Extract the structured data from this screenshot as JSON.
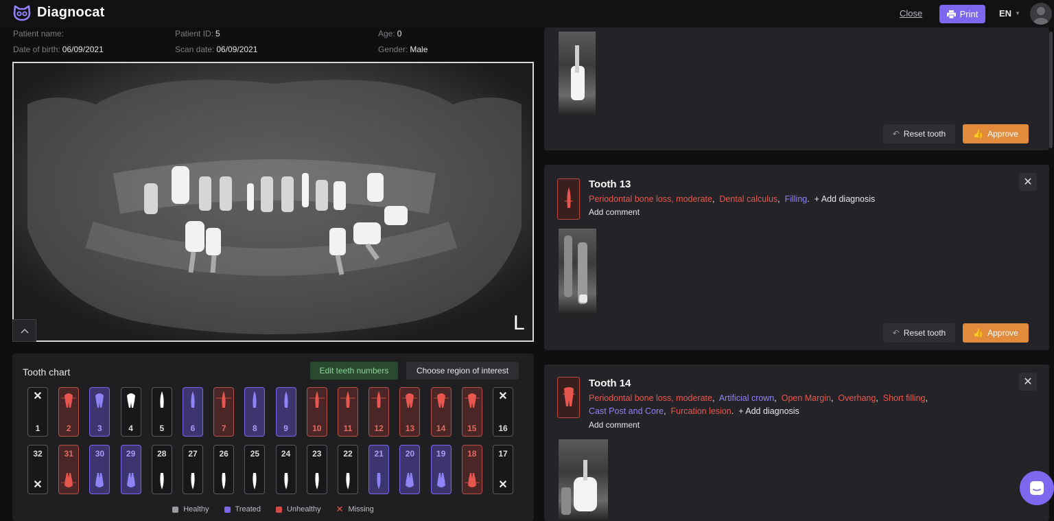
{
  "header": {
    "logo_text": "Diagnocat",
    "close_label": "Close",
    "print_label": "Print",
    "language": "EN"
  },
  "patient": {
    "name_label": "Patient name:",
    "name_value": "",
    "id_label": "Patient ID:",
    "id_value": "5",
    "age_label": "Age:",
    "age_value": "0",
    "dob_label": "Date of birth:",
    "dob_value": "06/09/2021",
    "scan_label": "Scan date:",
    "scan_value": "06/09/2021",
    "gender_label": "Gender:",
    "gender_value": "Male"
  },
  "xray": {
    "corner_label": "L"
  },
  "tooth_chart": {
    "title": "Tooth chart",
    "edit_label": "Edit teeth numbers",
    "roi_label": "Choose region of interest",
    "upper": [
      {
        "num": "1",
        "status": "missing"
      },
      {
        "num": "2",
        "status": "unhealthy"
      },
      {
        "num": "3",
        "status": "treated"
      },
      {
        "num": "4",
        "status": "healthy"
      },
      {
        "num": "5",
        "status": "healthy"
      },
      {
        "num": "6",
        "status": "treated"
      },
      {
        "num": "7",
        "status": "unhealthy"
      },
      {
        "num": "8",
        "status": "treated"
      },
      {
        "num": "9",
        "status": "treated"
      },
      {
        "num": "10",
        "status": "unhealthy"
      },
      {
        "num": "11",
        "status": "unhealthy"
      },
      {
        "num": "12",
        "status": "unhealthy"
      },
      {
        "num": "13",
        "status": "unhealthy"
      },
      {
        "num": "14",
        "status": "unhealthy"
      },
      {
        "num": "15",
        "status": "unhealthy"
      },
      {
        "num": "16",
        "status": "missing"
      }
    ],
    "lower": [
      {
        "num": "32",
        "status": "missing"
      },
      {
        "num": "31",
        "status": "unhealthy"
      },
      {
        "num": "30",
        "status": "treated"
      },
      {
        "num": "29",
        "status": "treated"
      },
      {
        "num": "28",
        "status": "healthy"
      },
      {
        "num": "27",
        "status": "healthy"
      },
      {
        "num": "26",
        "status": "healthy"
      },
      {
        "num": "25",
        "status": "healthy"
      },
      {
        "num": "24",
        "status": "healthy"
      },
      {
        "num": "23",
        "status": "healthy"
      },
      {
        "num": "22",
        "status": "healthy"
      },
      {
        "num": "21",
        "status": "treated"
      },
      {
        "num": "20",
        "status": "treated"
      },
      {
        "num": "19",
        "status": "treated"
      },
      {
        "num": "18",
        "status": "unhealthy"
      },
      {
        "num": "17",
        "status": "missing"
      }
    ],
    "legend": {
      "healthy": "Healthy",
      "treated": "Treated",
      "unhealthy": "Unhealthy",
      "missing": "Missing"
    },
    "colors": {
      "healthy": "#9a9aa0",
      "treated": "#7b68ee",
      "unhealthy": "#d24b47",
      "missing": "#e8574f"
    }
  },
  "cards": {
    "reset_label": "Reset tooth",
    "approve_label": "Approve",
    "add_diagnosis": "+ Add diagnosis",
    "add_comment": "Add comment",
    "tooth13": {
      "title": "Tooth 13",
      "d1": "Periodontal bone loss, moderate",
      "d2": "Dental calculus",
      "d3": "Filling"
    },
    "tooth14": {
      "title": "Tooth 14",
      "d1": "Periodontal bone loss, moderate",
      "d2": "Artificial crown",
      "d3": "Open Margin",
      "d4": "Overhang",
      "d5": "Short filling",
      "d6": "Cast Post and Core",
      "d7": "Furcation lesion"
    }
  }
}
